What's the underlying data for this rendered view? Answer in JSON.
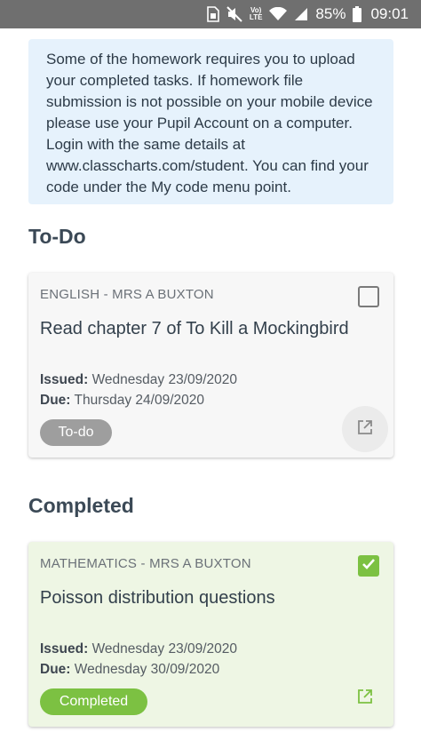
{
  "status_bar": {
    "battery": "85%",
    "time": "09:01",
    "volte": [
      "Vo)",
      "LTE"
    ],
    "icons": [
      "sim-icon",
      "mute-icon",
      "volte-icon",
      "wifi-icon",
      "signal-icon",
      "battery-icon"
    ]
  },
  "notice": {
    "text": "Some of the homework requires you to upload your completed tasks. If homework file submission is not possible on your mobile device please use your Pupil Account on a computer. Login with the same details at www.classcharts.com/student. You can find your code under the My code menu point."
  },
  "sections": {
    "todo": {
      "title": "To-Do",
      "card": {
        "subject": "ENGLISH - MRS A BUXTON",
        "task": "Read chapter 7 of To Kill a Mockingbird",
        "issued_label": "Issued:",
        "issued_date": "Wednesday 23/09/2020",
        "due_label": "Due:",
        "due_date": "Thursday 24/09/2020",
        "status": "To-do",
        "checked": false
      }
    },
    "completed": {
      "title": "Completed",
      "card": {
        "subject": "MATHEMATICS - MRS A BUXTON",
        "task": "Poisson distribution questions",
        "issued_label": "Issued:",
        "issued_date": "Wednesday 23/09/2020",
        "due_label": "Due:",
        "due_date": "Wednesday 30/09/2020",
        "status": "Completed",
        "checked": true
      }
    }
  },
  "colors": {
    "status_bar": "#6f6f6f",
    "notice_bg": "#e6f2fc",
    "todo_pill": "#9e9e9e",
    "completed_green": "#7cc142",
    "completed_card_bg": "#eef6e4"
  }
}
